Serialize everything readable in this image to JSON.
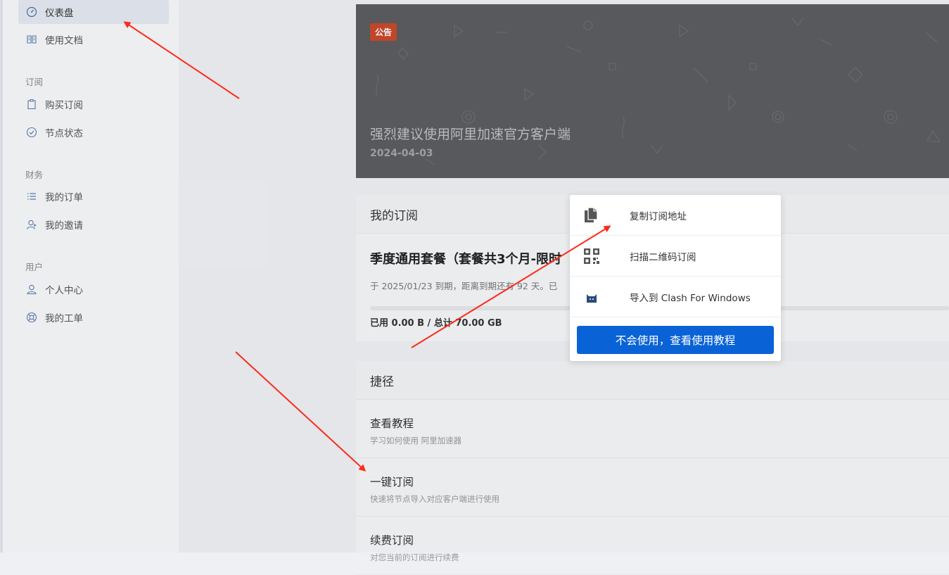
{
  "sidebar": {
    "items": [
      {
        "label": "仪表盘",
        "icon": "dashboard-icon",
        "active": true
      },
      {
        "label": "使用文档",
        "icon": "book-icon"
      },
      {
        "label": "购买订阅",
        "icon": "clipboard-icon"
      },
      {
        "label": "节点状态",
        "icon": "check-circle-icon"
      },
      {
        "label": "我的订单",
        "icon": "list-icon"
      },
      {
        "label": "我的邀请",
        "icon": "invite-user-icon"
      },
      {
        "label": "个人中心",
        "icon": "user-icon"
      },
      {
        "label": "我的工单",
        "icon": "support-icon"
      }
    ],
    "sections": [
      "订阅",
      "财务",
      "用户"
    ]
  },
  "announcement": {
    "tag": "公告",
    "title": "强烈建议使用阿里加速官方客户端",
    "date": "2024-04-03"
  },
  "subscription": {
    "header": "我的订阅",
    "plan": "季度通用套餐（套餐共3个月-限时",
    "expire_text": "于 2025/01/23 到期，距离到期还有 92 天。已",
    "usage": "已用 0.00 B / 总计 70.00 GB"
  },
  "shortcuts": {
    "header": "捷径",
    "items": [
      {
        "title": "查看教程",
        "desc": "学习如何使用 阿里加速器"
      },
      {
        "title": "一键订阅",
        "desc": "快速将节点导入对应客户端进行使用"
      },
      {
        "title": "续费订阅",
        "desc": "对您当前的订阅进行续费"
      }
    ]
  },
  "popup": {
    "items": [
      {
        "label": "复制订阅地址",
        "icon": "copy-icon"
      },
      {
        "label": "扫描二维码订阅",
        "icon": "qrcode-icon"
      },
      {
        "label": "导入到 Clash For Windows",
        "icon": "clash-cat-icon"
      }
    ],
    "button": "不会使用，查看使用教程"
  },
  "colors": {
    "accent": "#0a63d6",
    "tag": "#c9482a",
    "arrow": "#ff2a1a"
  }
}
